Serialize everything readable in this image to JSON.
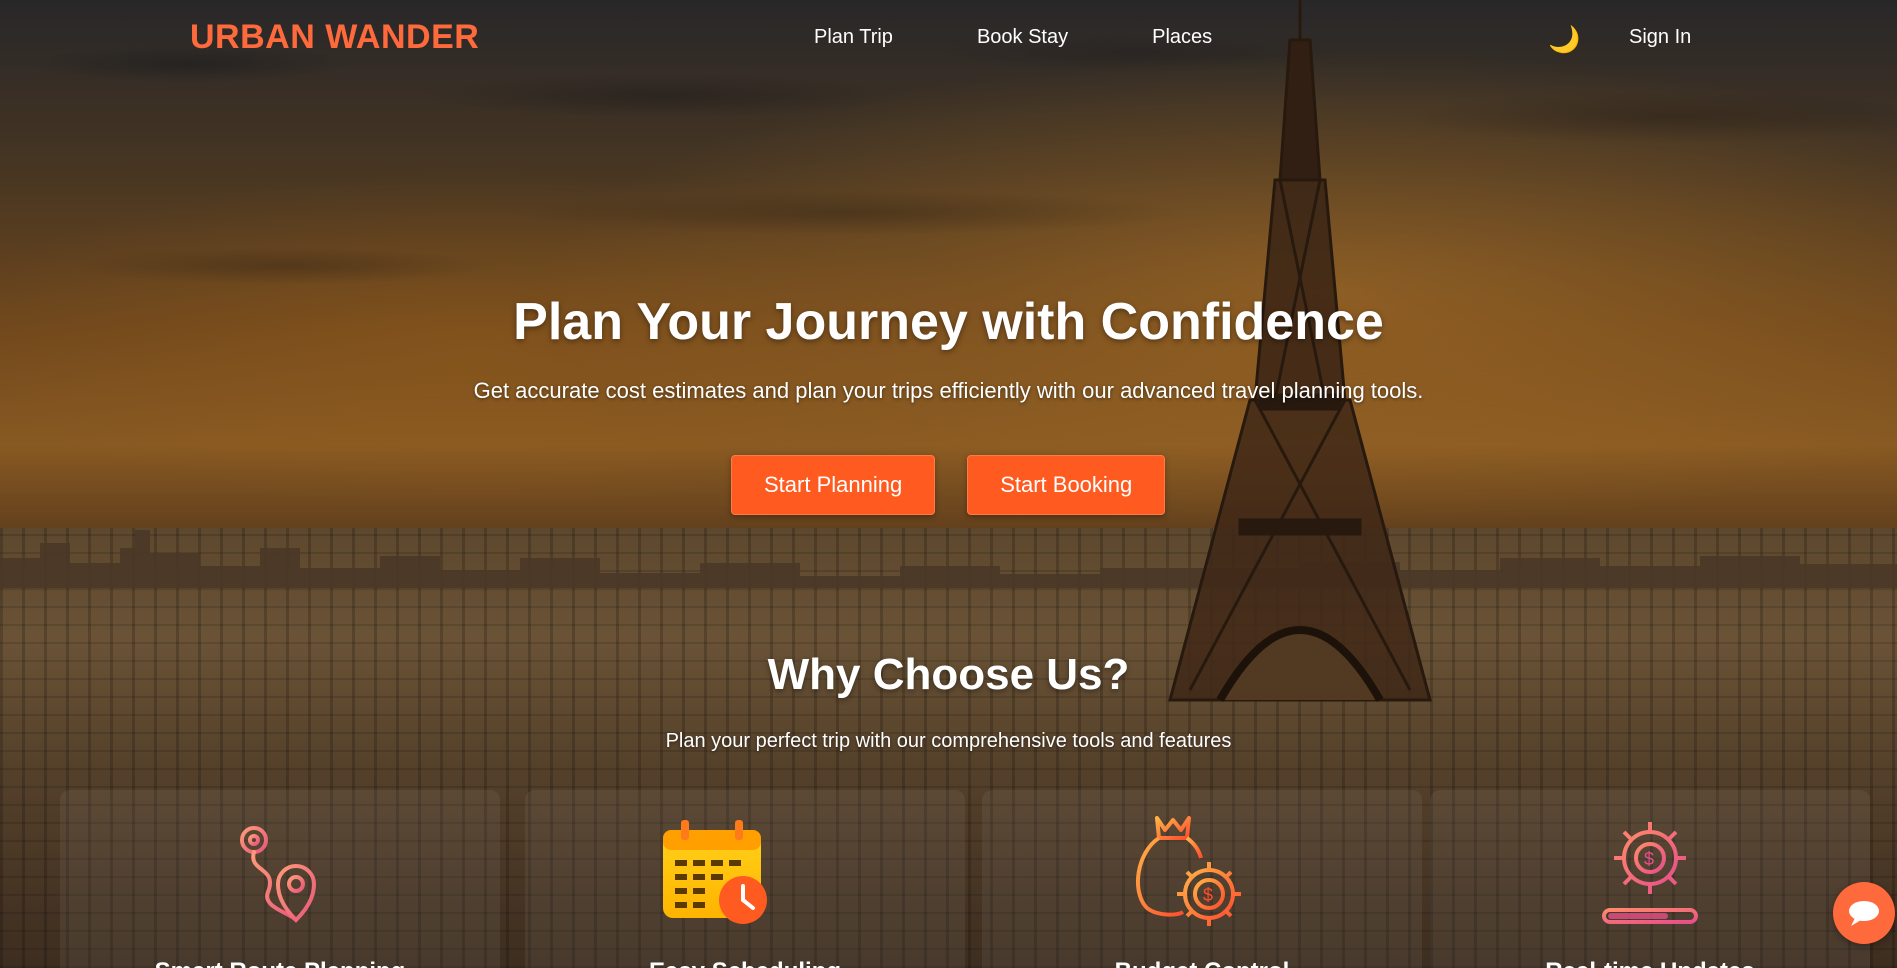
{
  "brand": {
    "name": "URBAN WANDER",
    "color": "#ff6a3d"
  },
  "nav": {
    "links": [
      {
        "label": "Plan Trip"
      },
      {
        "label": "Book Stay"
      },
      {
        "label": "Places"
      }
    ],
    "theme_icon": "🌙",
    "sign_in": "Sign In"
  },
  "hero": {
    "title": "Plan Your Journey with Confidence",
    "subtitle": "Get accurate cost estimates and plan your trips efficiently with our advanced travel planning tools.",
    "buttons": [
      {
        "label": "Start Planning"
      },
      {
        "label": "Start Booking"
      }
    ],
    "button_color": "#ff5a1f"
  },
  "why": {
    "title": "Why Choose Us?",
    "subtitle": "Plan your perfect trip with our comprehensive tools and features",
    "features": [
      {
        "icon": "route-pin-icon",
        "label": "Smart Route Planning"
      },
      {
        "icon": "calendar-clock-icon",
        "label": "Easy Scheduling"
      },
      {
        "icon": "money-bag-gear-icon",
        "label": "Budget Control"
      },
      {
        "icon": "gear-dollar-progress-icon",
        "label": "Real-time Updates"
      }
    ]
  },
  "chat": {
    "icon": "chat-bubble-icon"
  }
}
